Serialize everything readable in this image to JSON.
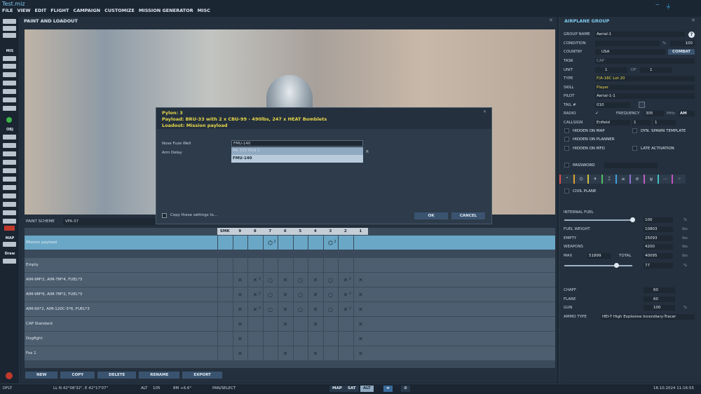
{
  "app": {
    "filename": "Test.miz"
  },
  "menu": [
    "FILE",
    "VIEW",
    "EDIT",
    "FLIGHT",
    "CAMPAIGN",
    "CUSTOMIZE",
    "MISSION GENERATOR",
    "MISC"
  ],
  "leftbar": {
    "mis_label": "MIS",
    "obj_label": "OBJ",
    "map_label": "MAP",
    "draw_label": "Draw"
  },
  "paint": {
    "title": "PAINT AND LOADOUT",
    "scheme_label": "PAINT SCHEME",
    "scheme_value": "VFA-37",
    "columns": [
      "SMK",
      "9",
      "8",
      "7",
      "6",
      "5",
      "4",
      "3",
      "2",
      "1"
    ],
    "rows": [
      {
        "name": "Mission payload",
        "selected": true,
        "cells": [
          "",
          "",
          "",
          "⌬",
          "",
          "",
          "",
          "⌬",
          "",
          ""
        ],
        "counts": [
          "",
          "",
          "",
          "2",
          "",
          "",
          "",
          "2",
          "",
          ""
        ]
      },
      {
        "name": "Empty",
        "cells": [
          "",
          "",
          "",
          "",
          "",
          "",
          "",
          "",
          "",
          ""
        ],
        "counts": [
          "",
          "",
          "",
          "",
          "",
          "",
          "",
          "",
          "",
          ""
        ]
      },
      {
        "name": "AIM-9M*2, AIM-7M*4, FUEL*3",
        "cells": [
          "",
          "✕",
          "✕",
          "○",
          "✕",
          "○",
          "✕",
          "○",
          "✕",
          "✕"
        ],
        "counts": [
          "",
          "",
          "2",
          "",
          "",
          "",
          "",
          "",
          "2",
          ""
        ]
      },
      {
        "name": "AIM-9M*6, AIM-7M*2, FUEL*3",
        "cells": [
          "",
          "✕",
          "✕",
          "○",
          "✕",
          "○",
          "✕",
          "○",
          "✕",
          "✕"
        ],
        "counts": [
          "",
          "",
          "2",
          "",
          "",
          "",
          "",
          "",
          "2",
          ""
        ]
      },
      {
        "name": "AIM-9X*2, AIM-120C-5*6, FUEL*3",
        "cells": [
          "",
          "✕",
          "✕",
          "○",
          "✕",
          "○",
          "✕",
          "○",
          "✕",
          "✕"
        ],
        "counts": [
          "",
          "",
          "2",
          "",
          "",
          "",
          "",
          "",
          "2",
          ""
        ]
      },
      {
        "name": "CAP Standard",
        "cells": [
          "",
          "✕",
          "",
          "",
          "✕",
          "",
          "✕",
          "",
          "",
          "✕"
        ],
        "counts": [
          "",
          "",
          "",
          "",
          "",
          "",
          "",
          "",
          "",
          ""
        ]
      },
      {
        "name": "Dogfight",
        "cells": [
          "",
          "✕",
          "",
          "",
          "",
          "",
          "",
          "",
          "",
          "✕"
        ],
        "counts": [
          "",
          "",
          "",
          "",
          "",
          "",
          "",
          "",
          "",
          ""
        ]
      },
      {
        "name": "Fox 1",
        "cells": [
          "",
          "✕",
          "",
          "",
          "✕",
          "",
          "✕",
          "",
          "",
          "✕"
        ],
        "counts": [
          "",
          "",
          "",
          "",
          "",
          "",
          "",
          "",
          "",
          ""
        ]
      }
    ],
    "buttons": [
      "NEW",
      "COPY",
      "DELETE",
      "RENAME",
      "EXPORT"
    ]
  },
  "dialog": {
    "pylon": "Pylon: 3",
    "payload": "Payload: BRU-33 with 2 x CBU-99 - 490lbs, 247 x HEAT Bomblets",
    "loadout": "Loadout: Mission payload",
    "fuze_label": "Nose Fuze Well",
    "fuze_value": "FMU-140",
    "fuze_options": [
      "Mk 339 Mod 1",
      "FMU-140"
    ],
    "arm_label": "Arm Delay",
    "arm_unit": "ft",
    "copy_label": "Copy these settings to...",
    "ok": "OK",
    "cancel": "CANCEL"
  },
  "group": {
    "title": "AIRPLANE GROUP",
    "group_name_label": "GROUP NAME",
    "group_name": "Aerial-1",
    "condition_label": "CONDITION",
    "condition_unit": "%",
    "condition_value": "100",
    "country_label": "COUNTRY",
    "country": "USA",
    "combat": "COMBAT",
    "task_label": "TASK",
    "task": "CAP",
    "unit_label": "UNIT",
    "unit": "1",
    "of_label": "OF",
    "unit_of": "1",
    "type_label": "TYPE",
    "type": "F/A-18C Lot 20",
    "skill_label": "SKILL",
    "skill": "Player",
    "pilot_label": "PILOT",
    "pilot": "Aerial-1-1",
    "tail_label": "TAIL #",
    "tail": "010",
    "radio_label": "RADIO",
    "freq_label": "FREQUENCY",
    "freq": "305",
    "freq_unit": "MHz",
    "mod": "AM",
    "callsign_label": "CALLSIGN",
    "callsign": "Enfield",
    "cs1": "1",
    "cs2": "1",
    "hidden_map": "HIDDEN ON MAP",
    "dyn_spawn": "DYN. SPAWN TEMPLATE",
    "hidden_planner": "HIDDEN ON PLANNER",
    "hidden_mfd": "HIDDEN ON MFD",
    "late_act": "LATE ACTIVATION",
    "password_label": "PASSWORD",
    "civil_plane": "CIVIL PLANE",
    "internal_fuel_label": "INTERNAL FUEL",
    "internal_fuel": "100",
    "fuel_pct": "%",
    "fuel_weight_label": "FUEL WEIGHT",
    "fuel_weight": "10803",
    "empty_label": "EMPTY",
    "empty": "25093",
    "weapons_label": "WEAPONS",
    "weapons": "4200",
    "max_label": "MAX",
    "max": "51899",
    "total_label": "TOTAL",
    "total": "40095",
    "lbs": "lbs",
    "load_pct": "77",
    "chaff_label": "CHAFF",
    "chaff": "60",
    "flare_label": "FLARE",
    "flare": "60",
    "gun_label": "GUN",
    "gun": "100",
    "ammo_label": "AMMO TYPE",
    "ammo": "HEI-T High Explosive Incendiary-Tracer",
    "internal_fuel_frac": 1.0,
    "load_frac": 0.77
  },
  "status": {
    "mode": "DFLT",
    "coords": "LL  N 42°08'32\", E 42°17'07\"",
    "alt_label": "ALT",
    "alt": "105",
    "scale": "8M  +6.6°",
    "tool": "PAN/SELECT",
    "map": "MAP",
    "sat": "SAT",
    "alt_btn": "ALT",
    "datetime": "18.10.2024 11:16:55"
  }
}
